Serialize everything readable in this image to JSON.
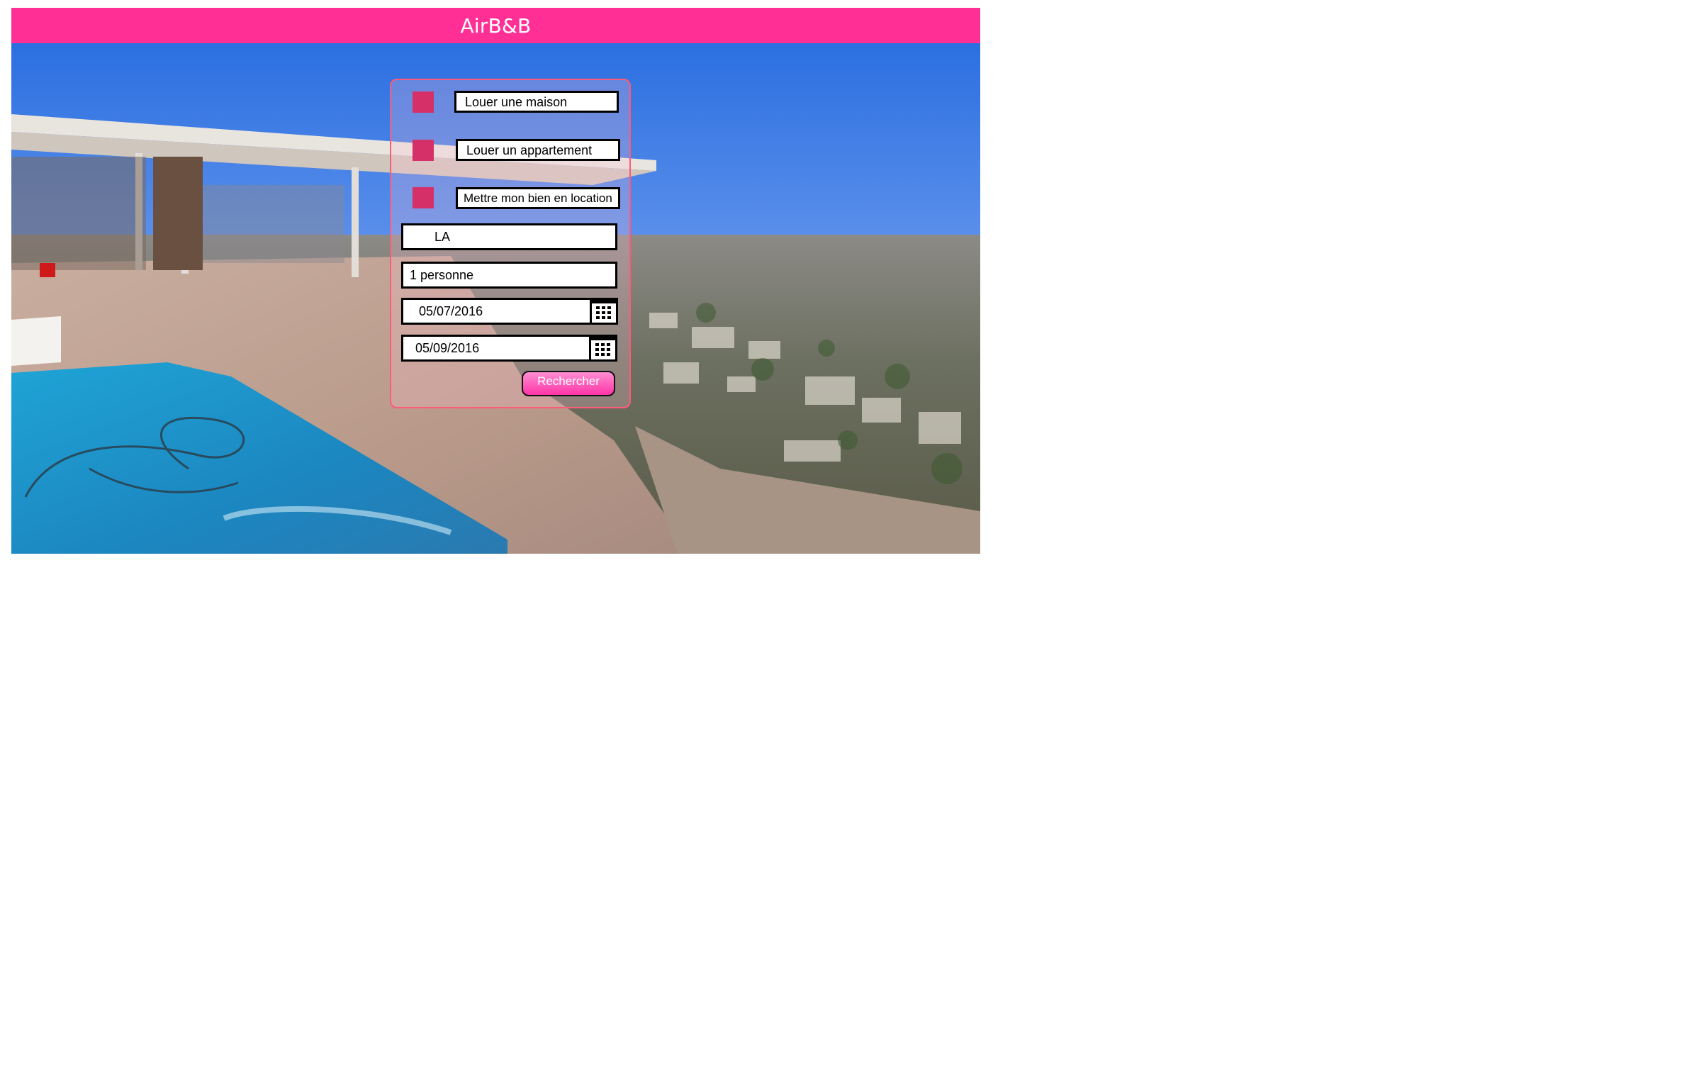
{
  "header": {
    "brand": "AirB&B"
  },
  "colors": {
    "brand": "#ff2f96",
    "checkbox": "#d63068",
    "panel_border": "#ff5a78",
    "button_top": "#ff8fd0",
    "button_bottom": "#ff34a8"
  },
  "search_panel": {
    "options": [
      {
        "label": "Louer une maison"
      },
      {
        "label": "Louer un appartement"
      },
      {
        "label": "Mettre mon bien en location"
      }
    ],
    "destination": {
      "value": "LA"
    },
    "guests": {
      "value": "1 personne"
    },
    "start_date": {
      "value": "05/07/2016",
      "icon": "calendar-icon"
    },
    "end_date": {
      "value": "05/09/2016",
      "icon": "calendar-icon"
    },
    "search_button": {
      "label": "Rechercher"
    }
  },
  "background": {
    "icon": "hero-photo-pool-city-view"
  }
}
